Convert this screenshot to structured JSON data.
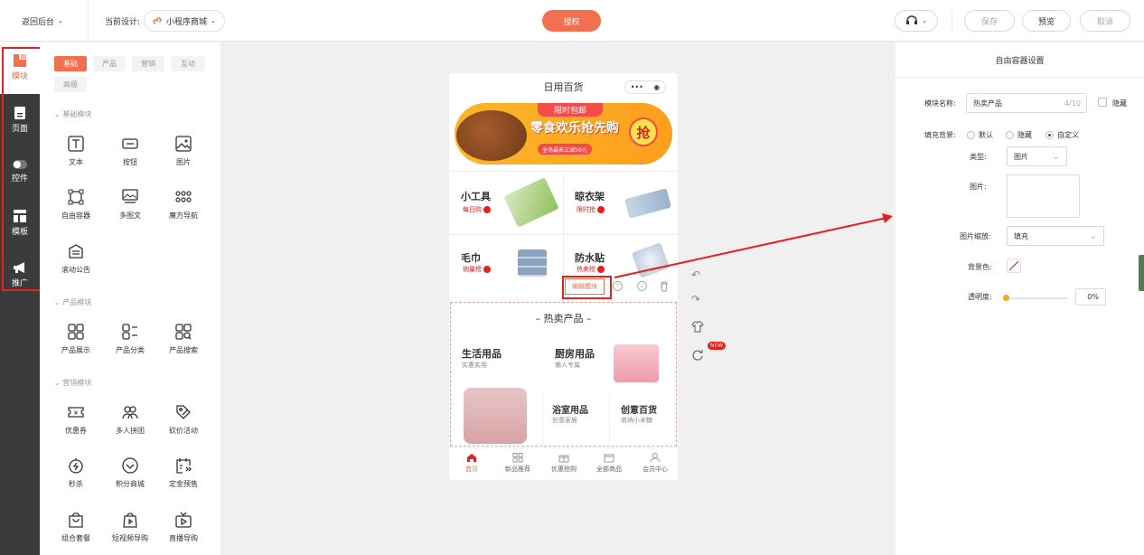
{
  "topbar": {
    "back": "返回后台",
    "current_label": "当前设计:",
    "design_name": "小程序商城",
    "auth": "授权",
    "save": "保存",
    "preview": "预览",
    "cancel": "取消"
  },
  "rail": {
    "items": [
      "模块",
      "页面",
      "控件",
      "模板",
      "推广"
    ]
  },
  "panel": {
    "tabs": [
      "基础",
      "产品",
      "营销",
      "互动",
      "高级"
    ],
    "sections": [
      {
        "title": "基础模块",
        "items": [
          "文本",
          "按钮",
          "图片",
          "自由容器",
          "多图文",
          "魔方导航",
          "滚动公告"
        ]
      },
      {
        "title": "产品模块",
        "items": [
          "产品展示",
          "产品分类",
          "产品搜索"
        ]
      },
      {
        "title": "营销模块",
        "items": [
          "优惠券",
          "多人拼团",
          "砍价活动",
          "秒杀",
          "积分商城",
          "定金预售",
          "组合套餐",
          "短视频导购",
          "直播导购"
        ]
      }
    ]
  },
  "phone": {
    "title": "日用百货",
    "banner_top": "限时包邮",
    "banner_main": "零食欢乐抢先购",
    "banner_sub": "全场最高立减50元",
    "banner_btn": "抢",
    "cells": [
      {
        "title": "小工具",
        "badge": "每日购"
      },
      {
        "title": "晾衣架",
        "badge": "限时抢"
      },
      {
        "title": "毛巾",
        "badge": "销量榜"
      },
      {
        "title": "防水贴",
        "badge": "热卖榜"
      }
    ],
    "edit_label": "编辑模块",
    "section_title": "热卖产品",
    "hot": [
      {
        "title": "生活用品",
        "sub": "实惠实用"
      },
      {
        "title": "厨房用品",
        "sub": "懒人专属"
      },
      {
        "title": "浴室用品",
        "sub": "创意家居"
      },
      {
        "title": "创意百货",
        "sub": "收纳小米糖"
      }
    ],
    "nav": [
      "首页",
      "新品推荐",
      "优惠抢购",
      "全部商品",
      "会员中心"
    ]
  },
  "side_new": "NEW",
  "settings": {
    "title": "自由容器设置",
    "name_label": "模块名称:",
    "name_value": "热卖产品",
    "name_count": "4/10",
    "hide_label": "隐藏",
    "fill_label": "填充背景:",
    "fill_opts": [
      "默认",
      "隐藏",
      "自定义"
    ],
    "type_label": "类型:",
    "type_value": "图片",
    "image_label": "图片:",
    "scale_label": "图片缩放:",
    "scale_value": "填充",
    "bg_label": "背景色:",
    "opacity_label": "透明度:",
    "opacity_value": "0%"
  },
  "colors": {
    "accent": "#f2704f",
    "annotation_red": "#e5201e"
  }
}
